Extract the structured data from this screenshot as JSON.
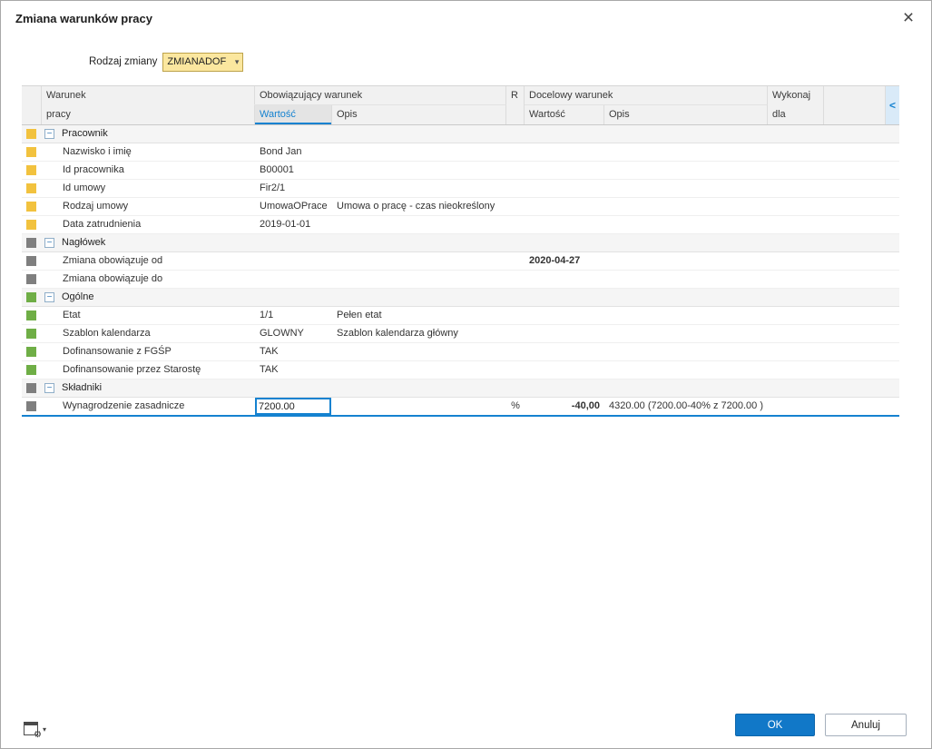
{
  "icons": {
    "close": "×",
    "combo_arrow": "▾",
    "collapse_minus": "−",
    "panel_collapse": "<",
    "gear": "⚙",
    "settings_arrow": "▾"
  },
  "colors": {
    "accent_blue": "#1582D0",
    "ok_blue": "#1178C8",
    "group_yellow": "#F2C23E",
    "group_gray": "#7F7F7F",
    "group_green": "#6FAE46"
  },
  "dialog": {
    "title": "Zmiana warunków pracy"
  },
  "toolbar": {
    "change_type_label": "Rodzaj zmiany",
    "change_type_value": "ZMIANADOF"
  },
  "grid": {
    "header": {
      "warunek_line1": "Warunek",
      "warunek_line2": "pracy",
      "current_group": "Obowiązujący warunek",
      "current_value": "Wartość",
      "current_desc": "Opis",
      "r": "R",
      "target_group": "Docelowy warunek",
      "target_value": "Wartość",
      "target_desc": "Opis",
      "execute_line1": "Wykonaj",
      "execute_line2": "dla"
    },
    "groups": [
      {
        "name": "Pracownik",
        "color": "#F2C23E",
        "rows": [
          {
            "label": "Nazwisko i imię",
            "cur_value": "Bond Jan"
          },
          {
            "label": "Id pracownika",
            "cur_value": "B00001"
          },
          {
            "label": "Id umowy",
            "cur_value": "Fir2/1"
          },
          {
            "label": "Rodzaj umowy",
            "cur_value": "UmowaOPrace",
            "cur_desc": "Umowa o pracę - czas nieokreślony"
          },
          {
            "label": "Data zatrudnienia",
            "cur_value": "2019-01-01"
          }
        ]
      },
      {
        "name": "Nagłówek",
        "color": "#7F7F7F",
        "rows": [
          {
            "label": "Zmiana obowiązuje od",
            "tgt_value": "2020-04-27",
            "tgt_bold": true
          },
          {
            "label": "Zmiana obowiązuje do"
          }
        ]
      },
      {
        "name": "Ogólne",
        "color": "#6FAE46",
        "rows": [
          {
            "label": "Etat",
            "cur_value": "1/1",
            "cur_desc": "Pełen etat"
          },
          {
            "label": "Szablon kalendarza",
            "cur_value": "GLOWNY",
            "cur_desc": "Szablon kalendarza główny"
          },
          {
            "label": "Dofinansowanie z FGŚP",
            "cur_value": "TAK"
          },
          {
            "label": "Dofinansowanie przez Starostę",
            "cur_value": "TAK"
          }
        ]
      },
      {
        "name": "Składniki",
        "color": "#7F7F7F",
        "rows": [
          {
            "label": "Wynagrodzenie zasadnicze",
            "cur_value": "7200.00",
            "editing": true,
            "selected": true,
            "r": "%",
            "tgt_value": "-40,00",
            "tgt_bold": true,
            "tgt_align": "right",
            "tgt_desc": "4320.00 (7200.00-40% z 7200.00 )"
          }
        ]
      }
    ]
  },
  "footer": {
    "ok_label": "OK",
    "cancel_label": "Anuluj"
  }
}
